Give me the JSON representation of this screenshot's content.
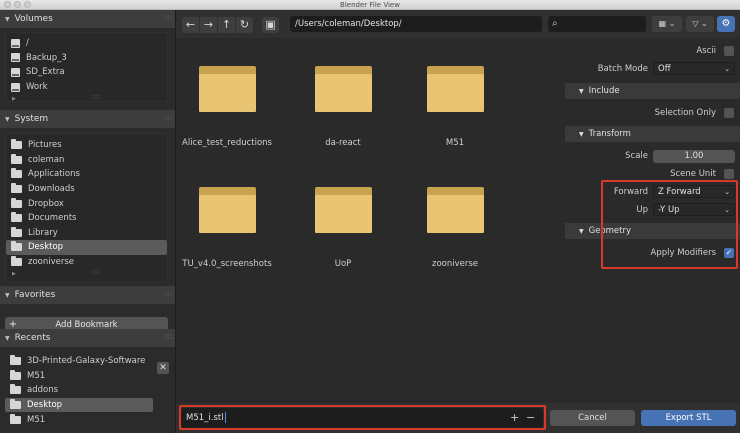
{
  "window": {
    "title": "Blender File View"
  },
  "sidebar": {
    "volumes": {
      "title": "Volumes",
      "items": [
        {
          "label": "/",
          "selected": false
        },
        {
          "label": "Backup_3",
          "selected": false
        },
        {
          "label": "SD_Extra",
          "selected": false
        },
        {
          "label": "Work",
          "selected": false
        }
      ]
    },
    "system": {
      "title": "System",
      "items": [
        {
          "label": "Pictures",
          "selected": false
        },
        {
          "label": "coleman",
          "selected": false
        },
        {
          "label": "Applications",
          "selected": false
        },
        {
          "label": "Downloads",
          "selected": false
        },
        {
          "label": "Dropbox",
          "selected": false
        },
        {
          "label": "Documents",
          "selected": false
        },
        {
          "label": "Library",
          "selected": false
        },
        {
          "label": "Desktop",
          "selected": true
        },
        {
          "label": "zooniverse",
          "selected": false
        }
      ]
    },
    "favorites": {
      "title": "Favorites",
      "add_bookmark": "Add Bookmark"
    },
    "recents": {
      "title": "Recents",
      "items": [
        {
          "label": "3D-Printed-Galaxy-Software",
          "selected": false
        },
        {
          "label": "M51",
          "selected": false
        },
        {
          "label": "addons",
          "selected": false
        },
        {
          "label": "Desktop",
          "selected": true
        },
        {
          "label": "M51",
          "selected": false
        }
      ]
    }
  },
  "toolbar": {
    "path": "/Users/coleman/Desktop/",
    "search_placeholder": ""
  },
  "files": [
    {
      "name": "Alice_test_reductions"
    },
    {
      "name": "da-react"
    },
    {
      "name": "M51"
    },
    {
      "name": "TU_v4.0_screenshots"
    },
    {
      "name": "UoP"
    },
    {
      "name": "zooniverse"
    }
  ],
  "properties": {
    "ascii": {
      "label": "Ascii",
      "checked": false
    },
    "batch_mode": {
      "label": "Batch Mode",
      "value": "Off"
    },
    "include": {
      "title": "Include",
      "selection_only": {
        "label": "Selection Only",
        "checked": false
      }
    },
    "transform": {
      "title": "Transform",
      "scale": {
        "label": "Scale",
        "value": "1.00"
      },
      "scene_unit": {
        "label": "Scene Unit",
        "checked": false
      },
      "forward": {
        "label": "Forward",
        "value": "Z Forward"
      },
      "up": {
        "label": "Up",
        "value": "-Y Up"
      }
    },
    "geometry": {
      "title": "Geometry",
      "apply_modifiers": {
        "label": "Apply Modifiers",
        "checked": true
      }
    }
  },
  "bottom": {
    "filename": "M51_i.stl",
    "cancel": "Cancel",
    "export": "Export STL"
  },
  "colors": {
    "accent": "#4772b3",
    "folder": "#e9c472",
    "highlight": "#d83a2a"
  }
}
